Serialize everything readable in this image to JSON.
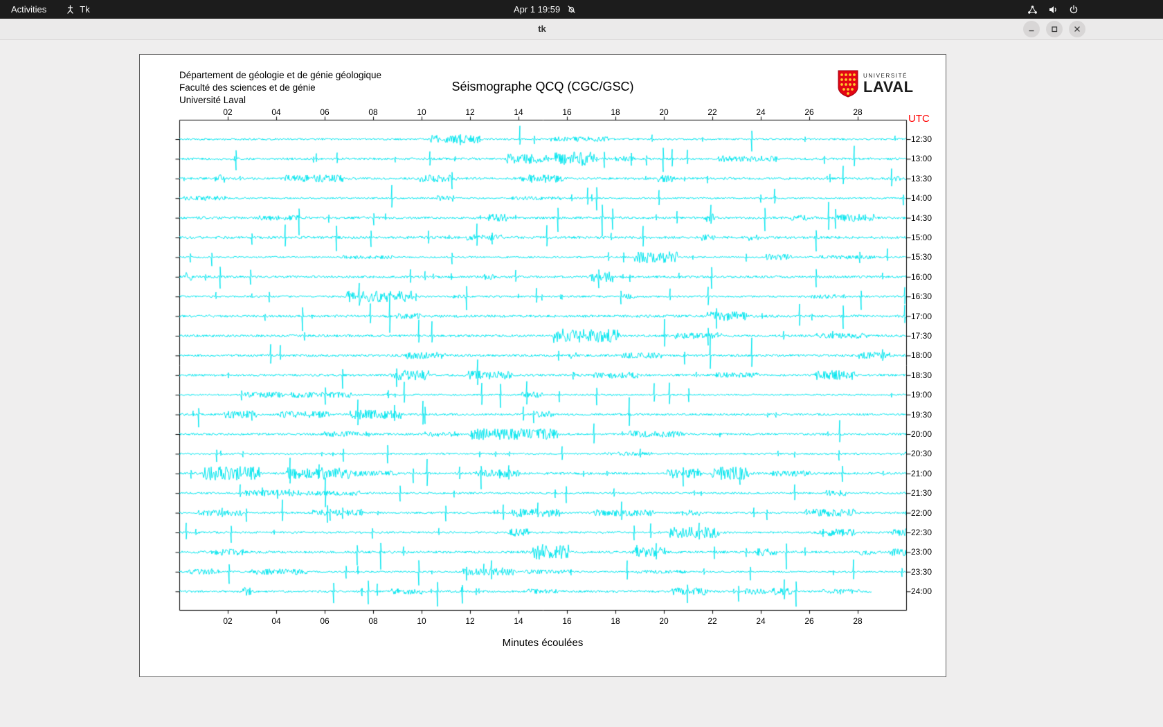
{
  "topbar": {
    "activities_label": "Activities",
    "app_indicator": "Tk",
    "clock": "Apr 1 19:59"
  },
  "titlebar": {
    "title": "tk"
  },
  "seismograph": {
    "institution_lines": [
      "Département de géologie et de génie géologique",
      "Faculté des sciences et de génie",
      "Université Laval"
    ],
    "title": "Séismographe QCQ (CGC/GSC)",
    "utc_label": "UTC",
    "x_axis_label": "Minutes écoulées",
    "x_ticks": [
      "02",
      "04",
      "06",
      "08",
      "10",
      "12",
      "14",
      "16",
      "18",
      "20",
      "22",
      "24",
      "26",
      "28"
    ],
    "row_labels": [
      "12:30",
      "13:00",
      "13:30",
      "14:00",
      "14:30",
      "15:00",
      "15:30",
      "16:00",
      "16:30",
      "17:00",
      "17:30",
      "18:00",
      "18:30",
      "19:00",
      "19:30",
      "20:00",
      "20:30",
      "21:00",
      "21:30",
      "22:00",
      "22:30",
      "23:00",
      "23:30",
      "24:00"
    ],
    "minutes_per_row": 30,
    "last_row_fraction": 0.953,
    "trace_color": "#00e5ee",
    "axis_color": "#000000",
    "utc_color": "#ff0000",
    "logo": {
      "top": "UNIVERSITÉ",
      "bottom": "LAVAL",
      "shield_color": "#e30513",
      "dot_color": "#ffc72c"
    }
  },
  "icons": {
    "topbar": [
      "tk-icon",
      "notifications-off-icon",
      "network-icon",
      "volume-icon",
      "power-icon"
    ],
    "titlebar": [
      "minimize-icon",
      "restore-icon",
      "close-icon"
    ]
  }
}
